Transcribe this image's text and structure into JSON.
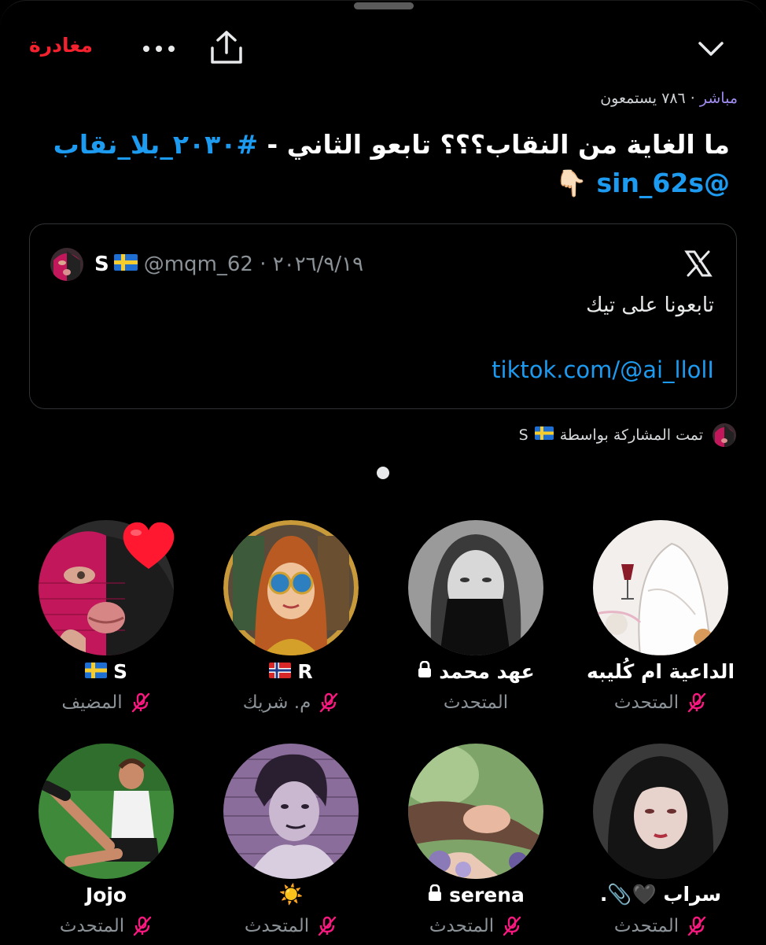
{
  "topbar": {
    "leave_label": "مغادرة",
    "more_label": "•••"
  },
  "space": {
    "live_label": "مباشر",
    "listeners_text": "٧٨٦ يستمعون",
    "title_text": "ما الغاية من النقاب؟؟؟ تابعو  الثاني - ",
    "title_hashtag": "#٢٠٣٠_بلا_نقاب",
    "title_mention": "@sin_62s",
    "title_emoji": "👇🏻"
  },
  "shared_card": {
    "author_name": "S",
    "author_flag": "sweden-flag",
    "handle_date": "@mqm_62 · ٢٠٢٦/٩/١٩",
    "text": "تابعونا على تيك",
    "link": "tiktok.com/@ai_llolI",
    "brand_icon": "x-logo-icon"
  },
  "shared_by": {
    "label": "تمت المشاركة بواسطة",
    "name": "S"
  },
  "speakers": [
    {
      "name": "S",
      "flag": "sweden",
      "role": "المضيف",
      "badge": "heart"
    },
    {
      "name": "R",
      "flag": "norway",
      "role": "م. شريك"
    },
    {
      "name": "عهد محمد",
      "lock": true,
      "role": "المتحدث"
    },
    {
      "name": "الداعية ام كُليبه",
      "role": "المتحدث"
    },
    {
      "name": "Jojo",
      "role": "المتحدث"
    },
    {
      "name": "☀️",
      "role": "المتحدث"
    },
    {
      "name": "serena",
      "lock": true,
      "role": "المتحدث"
    },
    {
      "name": "سراب 🖤📎.",
      "role": "المتحدث"
    }
  ],
  "colors": {
    "accent_blue": "#1d9bf0",
    "leave_red": "#f4212e",
    "live_purple": "#a18cf0",
    "mic_pink": "#f91880",
    "muted_text": "#8b9298"
  }
}
